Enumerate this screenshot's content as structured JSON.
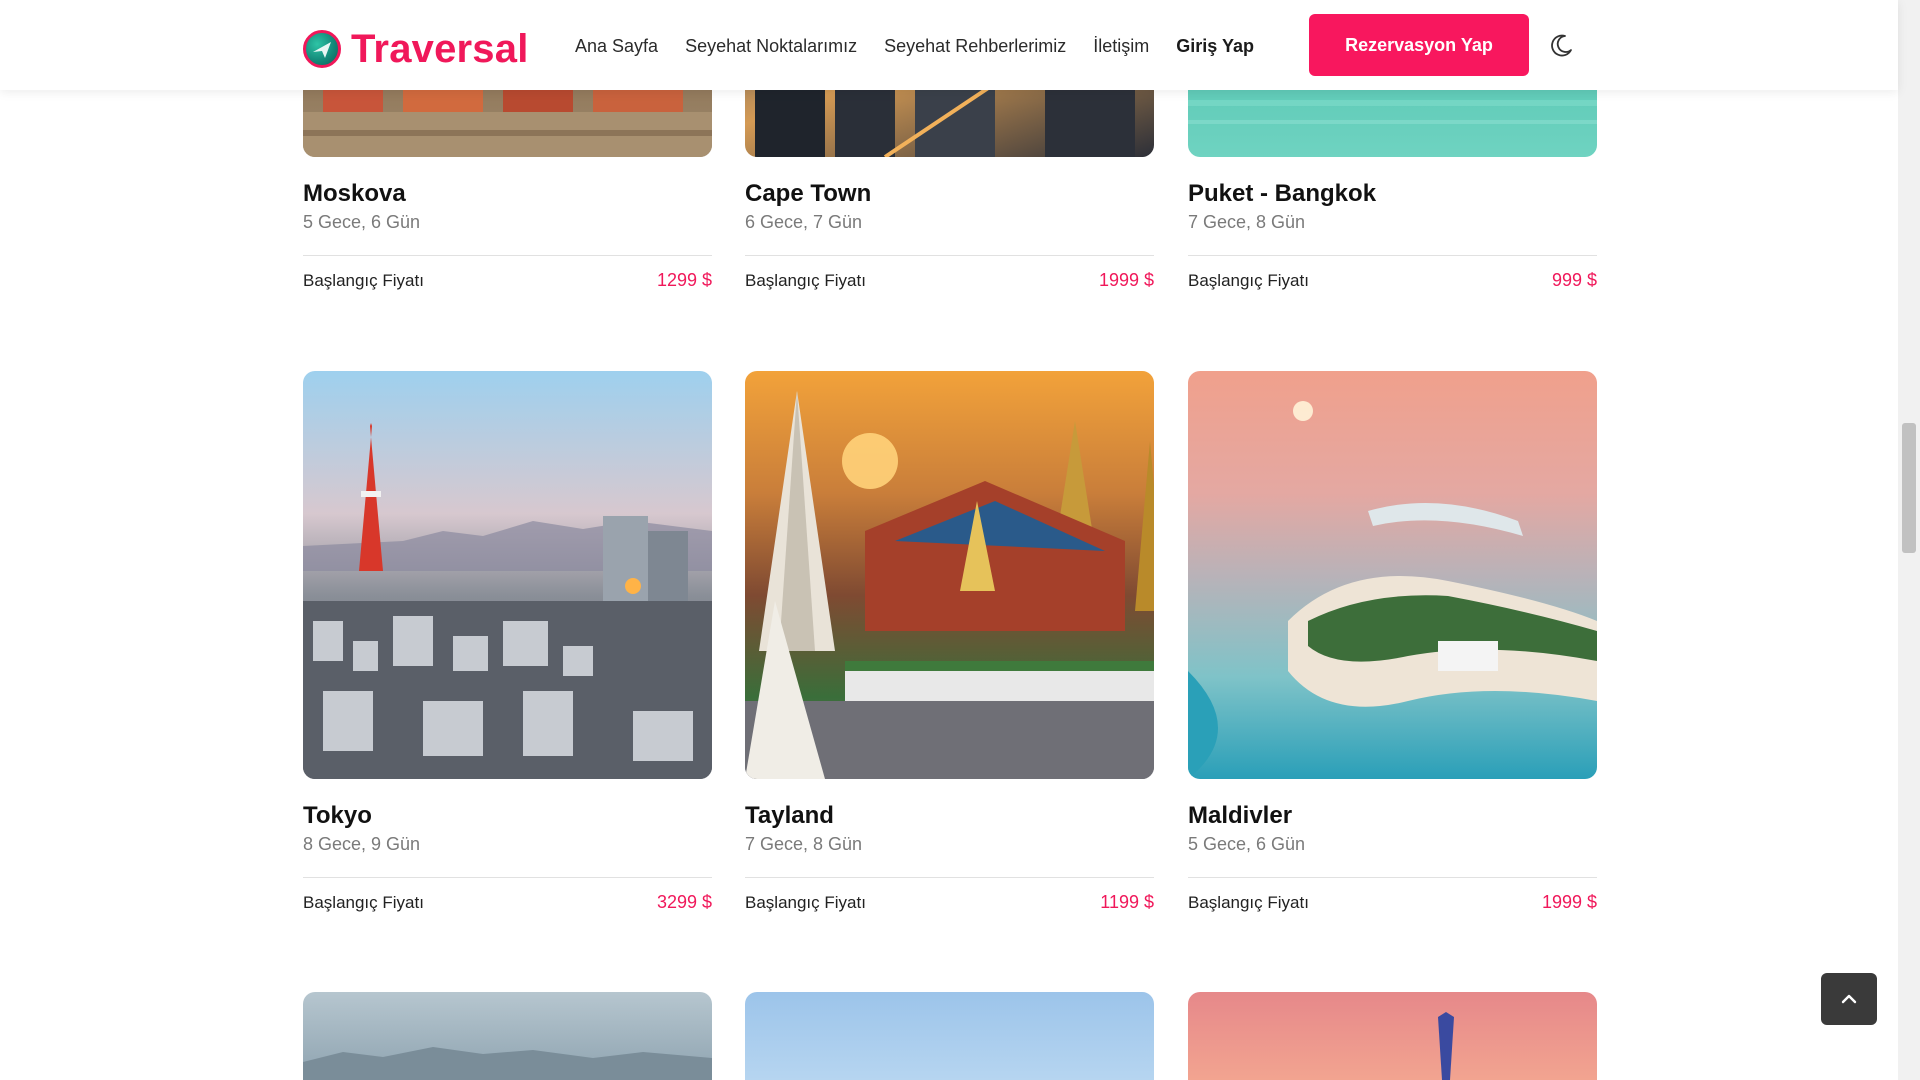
{
  "header": {
    "brand": "Traversal",
    "nav": [
      {
        "label": "Ana Sayfa"
      },
      {
        "label": "Seyehat Noktalarımız"
      },
      {
        "label": "Seyehat Rehberlerimiz"
      },
      {
        "label": "İletişim"
      },
      {
        "label": "Giriş Yap"
      }
    ],
    "reserve_label": "Rezervasyon Yap",
    "theme_icon": "moon-icon"
  },
  "colors": {
    "accent": "#f8175e",
    "price": "#f0185a"
  },
  "tours": [
    {
      "title": "Moskova",
      "duration": "5 Gece, 6 Gün",
      "price_label": "Başlangıç Fiyatı",
      "price": "1299 $"
    },
    {
      "title": "Cape Town",
      "duration": "6 Gece, 7 Gün",
      "price_label": "Başlangıç Fiyatı",
      "price": "1999 $"
    },
    {
      "title": "Puket - Bangkok",
      "duration": "7 Gece, 8 Gün",
      "price_label": "Başlangıç Fiyatı",
      "price": "999 $"
    },
    {
      "title": "Tokyo",
      "duration": "8 Gece, 9 Gün",
      "price_label": "Başlangıç Fiyatı",
      "price": "3299 $"
    },
    {
      "title": "Tayland",
      "duration": "7 Gece, 8 Gün",
      "price_label": "Başlangıç Fiyatı",
      "price": "1199 $"
    },
    {
      "title": "Maldivler",
      "duration": "5 Gece, 6 Gün",
      "price_label": "Başlangıç Fiyatı",
      "price": "1999 $"
    }
  ],
  "back_to_top_icon": "chevron-up-icon"
}
